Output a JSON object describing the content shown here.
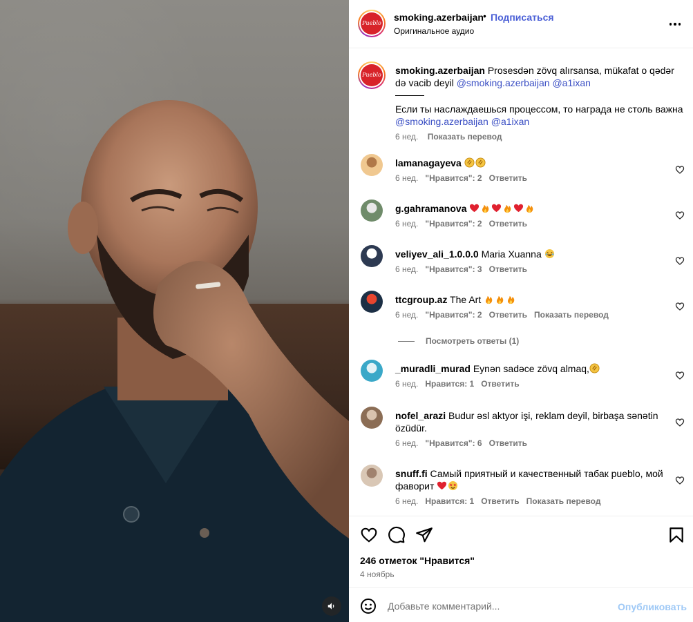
{
  "post": {
    "username": "smoking.azerbaijan",
    "dot": "•",
    "follow_label": "Подписаться",
    "audio": "Оригинальное аудио",
    "logo_text": "Pueblo"
  },
  "caption": {
    "username": "smoking.azerbaijan",
    "text": "Prosesdən zövq alırsansa, mükafat o qədər də vacib deyil",
    "mention_1": "@smoking.azerbaijan",
    "mention_2": "@a1ixan",
    "separator": "———",
    "text_ru": "Если ты наслаждаешься процессом, то награда не столь важна",
    "time": "6 нед.",
    "translate": "Показать перевод"
  },
  "comments": [
    {
      "username": "lamanagayeva",
      "text": "",
      "emojis": [
        "clap",
        "clap"
      ],
      "time": "6 нед.",
      "likes": "\"Нравится\": 2",
      "reply": "Ответить",
      "translate": ""
    },
    {
      "username": "g.gahramanova",
      "text": "",
      "emojis": [
        "heart",
        "fire",
        "heart",
        "fire",
        "heart",
        "fire"
      ],
      "time": "6 нед.",
      "likes": "\"Нравится\": 2",
      "reply": "Ответить",
      "translate": ""
    },
    {
      "username": "veliyev_ali_1.0.0.0",
      "text": "Maria Xuanna",
      "emojis": [
        "laugh"
      ],
      "time": "6 нед.",
      "likes": "\"Нравится\": 3",
      "reply": "Ответить",
      "translate": ""
    },
    {
      "username": "ttcgroup.az",
      "text": "The Art",
      "emojis": [
        "fire",
        "fire",
        "fire"
      ],
      "time": "6 нед.",
      "likes": "\"Нравится\": 2",
      "reply": "Ответить",
      "translate": "Показать перевод"
    },
    {
      "username": "_muradli_murad",
      "text": "Eynən sadəce zövq almaq,",
      "emojis": [
        "clap"
      ],
      "time": "6 нед.",
      "likes": "Нравится: 1",
      "reply": "Ответить",
      "translate": ""
    },
    {
      "username": "nofel_arazi",
      "text": "Budur əsl aktyor işi, reklam deyil, birbaşa sənətin",
      "text_line2": "özüdür.",
      "emojis": [],
      "time": "6 нед.",
      "likes": "\"Нравится\": 6",
      "reply": "Ответить",
      "translate": ""
    },
    {
      "username": "snuff.fi",
      "text": "Самый приятный и качественный табак pueblo, мой",
      "text_line2": "фаворит",
      "emojis": [
        "heart",
        "star-eyes"
      ],
      "time": "6 нед.",
      "likes": "Нравится: 1",
      "reply": "Ответить",
      "translate": "Показать перевод"
    }
  ],
  "view_replies": "Посмотреть ответы (1)",
  "likes_count": "246 отметок \"Нравится\"",
  "date": "4 ноябрь",
  "add_comment": {
    "placeholder": "Добавьте комментарий...",
    "publish_label": "Опубликовать"
  },
  "colors": {
    "accent": "#4a5fd6",
    "mention": "#3b4fc4",
    "muted": "#737373",
    "publish_disabled": "#9fc9f6",
    "brand_red": "#d8232a"
  },
  "icons": [
    "more-options-icon",
    "heart-icon",
    "comment-icon",
    "share-icon",
    "bookmark-icon",
    "emoji-icon",
    "sound-icon"
  ]
}
